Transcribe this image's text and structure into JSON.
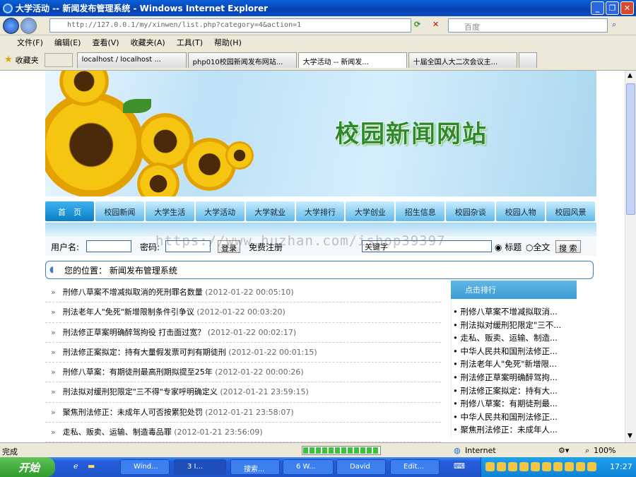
{
  "window": {
    "title": "大学活动 -- 新闻发布管理系统 - Windows Internet Explorer"
  },
  "addressbar": {
    "url": "http://127.0.0.1/my/xinwen/list.php?category=4&action=1",
    "search_placeholder": "百度"
  },
  "menu": [
    "文件(F)",
    "编辑(E)",
    "查看(V)",
    "收藏夹(A)",
    "工具(T)",
    "帮助(H)"
  ],
  "favorites_label": "收藏夹",
  "tabs": [
    "localhost / localhost ...",
    "php010校园新闻发布网站...",
    "大学活动 -- 新闻发...",
    "十届全国人大二次会议主..."
  ],
  "site": {
    "title": "校园新闻网站",
    "nav": [
      "首　页",
      "校园新闻",
      "大学生活",
      "大学活动",
      "大学就业",
      "大学排行",
      "大学创业",
      "招生信息",
      "校园杂谈",
      "校园人物",
      "校园风景"
    ],
    "login": {
      "username_label": "用户名:",
      "password_label": "密码:",
      "login_button": "登录",
      "register_link": "免费注册",
      "search_value": "关键字",
      "radio_title": "标题",
      "radio_fulltext": "全文",
      "search_button": "搜 索"
    },
    "location_label": "您的位置：",
    "location_value": "新闻发布管理系统",
    "news": [
      {
        "title": "刑修八草案不增减拟取消的死刑罪名数量",
        "date": "(2012-01-22 00:05:10)"
      },
      {
        "title": "刑法老年人\"免死\"新增限制条件引争议",
        "date": "(2012-01-22 00:03:20)"
      },
      {
        "title": "刑法修正草案明确醉驾拘役 打击面过宽？",
        "date": "(2012-01-22 00:02:17)"
      },
      {
        "title": "刑法修正案拟定：持有大量假发票可判有期徒刑",
        "date": "(2012-01-22 00:01:15)"
      },
      {
        "title": "刑修八草案：有期徒刑最高刑期拟提至25年",
        "date": "(2012-01-22 00:00:26)"
      },
      {
        "title": "刑法拟对缓刑犯限定\"三不得\"专家呼明确定义",
        "date": "(2012-01-21 23:59:15)"
      },
      {
        "title": "聚焦刑法修正：未成年人可否按累犯处罚",
        "date": "(2012-01-21 23:58:07)"
      },
      {
        "title": "走私、贩卖、运输、制造毒品罪",
        "date": "(2012-01-21 23:56:09)"
      }
    ],
    "ranking_title": "点击排行",
    "ranking": [
      "刑修八草案不增减拟取消...",
      "刑法拟对缓刑犯限定\"三不...",
      "走私、贩卖、运输、制造...",
      "中华人民共和国刑法修正...",
      "刑法老年人\"免死\"新增限...",
      "刑法修正草案明确醉驾拘...",
      "刑法修正案拟定：持有大...",
      "刑修八草案：有期徒刑最...",
      "中华人民共和国刑法修正...",
      "聚焦刑法修正：未成年人..."
    ],
    "watermark": "https://www.huzhan.com/ishop39397"
  },
  "statusbar": {
    "left": "完成",
    "zone": "Internet",
    "zoom": "100%"
  },
  "taskbar": {
    "start": "开始",
    "tasks": [
      "Wind...",
      "3 I...",
      "搜索...",
      "6 W...",
      "David",
      "Edit..."
    ],
    "clock": "17:27"
  },
  "colors": {
    "title_bar": "#0a5fd8",
    "nav_active": "#0a7fc4",
    "site_title_green": "#2d8a2b"
  }
}
